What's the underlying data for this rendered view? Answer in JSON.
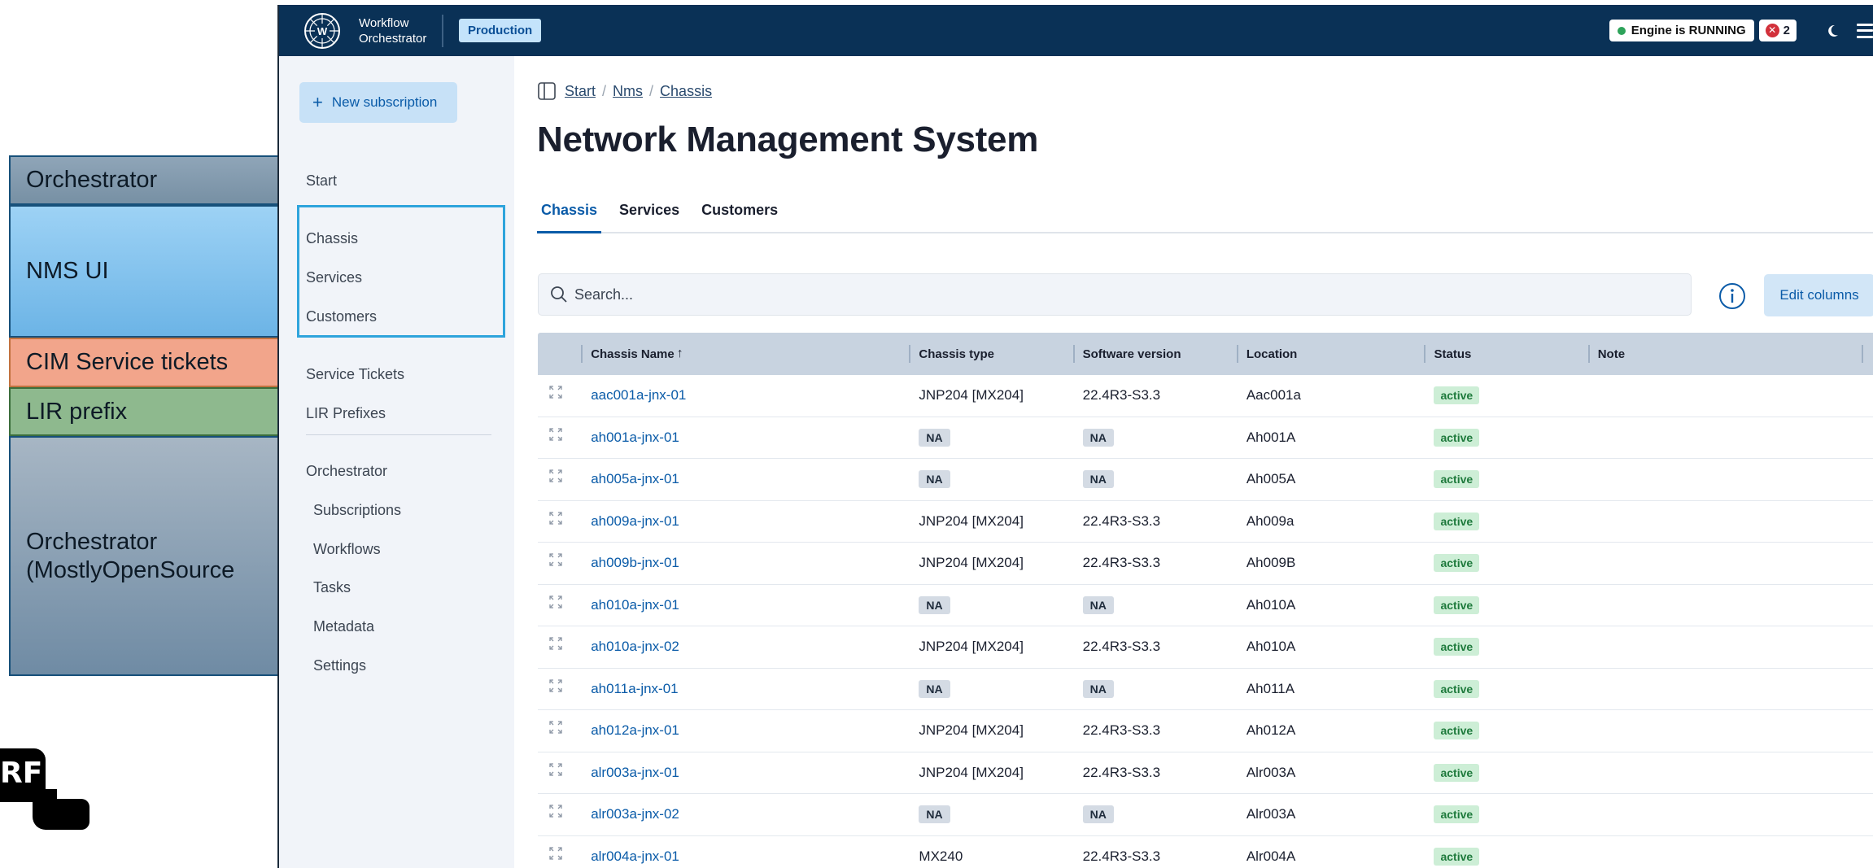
{
  "annotations": {
    "orchestrator": "Orchestrator",
    "nms_ui": "NMS UI",
    "cim": "CIM Service tickets",
    "lir": "LIR prefix",
    "mostly_open_source": "Orchestrator (MostlyOpenSource"
  },
  "logo_text": "RF",
  "topbar": {
    "app_title_line1": "Workflow",
    "app_title_line2": "Orchestrator",
    "environment": "Production",
    "engine_status": "Engine is RUNNING",
    "error_count": "2"
  },
  "sidebar": {
    "new_subscription": "New subscription",
    "items": [
      {
        "label": "Start"
      },
      {
        "label": "Chassis"
      },
      {
        "label": "Services"
      },
      {
        "label": "Customers"
      },
      {
        "label": "Service Tickets"
      },
      {
        "label": "LIR Prefixes"
      },
      {
        "label": "Orchestrator"
      },
      {
        "label": "Subscriptions"
      },
      {
        "label": "Workflows"
      },
      {
        "label": "Tasks"
      },
      {
        "label": "Metadata"
      },
      {
        "label": "Settings"
      }
    ]
  },
  "breadcrumb": [
    "Start",
    "Nms",
    "Chassis"
  ],
  "page_title": "Network Management System",
  "tabs": [
    {
      "label": "Chassis",
      "active": true
    },
    {
      "label": "Services",
      "active": false
    },
    {
      "label": "Customers",
      "active": false
    }
  ],
  "search": {
    "placeholder": "Search..."
  },
  "edit_columns": "Edit columns",
  "table": {
    "columns": [
      "Chassis Name",
      "Chassis type",
      "Software version",
      "Location",
      "Status",
      "Note"
    ],
    "sort_column": "Chassis Name",
    "sort_direction": "ascending",
    "rows": [
      {
        "name": "aac001a-jnx-01",
        "type": "JNP204 [MX204]",
        "version": "22.4R3-S3.3",
        "location": "Aac001a",
        "status": "active",
        "note": ""
      },
      {
        "name": "ah001a-jnx-01",
        "type": "NA",
        "version": "NA",
        "location": "Ah001A",
        "status": "active",
        "note": ""
      },
      {
        "name": "ah005a-jnx-01",
        "type": "NA",
        "version": "NA",
        "location": "Ah005A",
        "status": "active",
        "note": ""
      },
      {
        "name": "ah009a-jnx-01",
        "type": "JNP204 [MX204]",
        "version": "22.4R3-S3.3",
        "location": "Ah009a",
        "status": "active",
        "note": ""
      },
      {
        "name": "ah009b-jnx-01",
        "type": "JNP204 [MX204]",
        "version": "22.4R3-S3.3",
        "location": "Ah009B",
        "status": "active",
        "note": ""
      },
      {
        "name": "ah010a-jnx-01",
        "type": "NA",
        "version": "NA",
        "location": "Ah010A",
        "status": "active",
        "note": ""
      },
      {
        "name": "ah010a-jnx-02",
        "type": "JNP204 [MX204]",
        "version": "22.4R3-S3.3",
        "location": "Ah010A",
        "status": "active",
        "note": ""
      },
      {
        "name": "ah011a-jnx-01",
        "type": "NA",
        "version": "NA",
        "location": "Ah011A",
        "status": "active",
        "note": ""
      },
      {
        "name": "ah012a-jnx-01",
        "type": "JNP204 [MX204]",
        "version": "22.4R3-S3.3",
        "location": "Ah012A",
        "status": "active",
        "note": ""
      },
      {
        "name": "alr003a-jnx-01",
        "type": "JNP204 [MX204]",
        "version": "22.4R3-S3.3",
        "location": "Alr003A",
        "status": "active",
        "note": ""
      },
      {
        "name": "alr003a-jnx-02",
        "type": "NA",
        "version": "NA",
        "location": "Alr003A",
        "status": "active",
        "note": ""
      },
      {
        "name": "alr004a-jnx-01",
        "type": "MX240",
        "version": "22.4R3-S3.3",
        "location": "Alr004A",
        "status": "active",
        "note": ""
      }
    ]
  }
}
